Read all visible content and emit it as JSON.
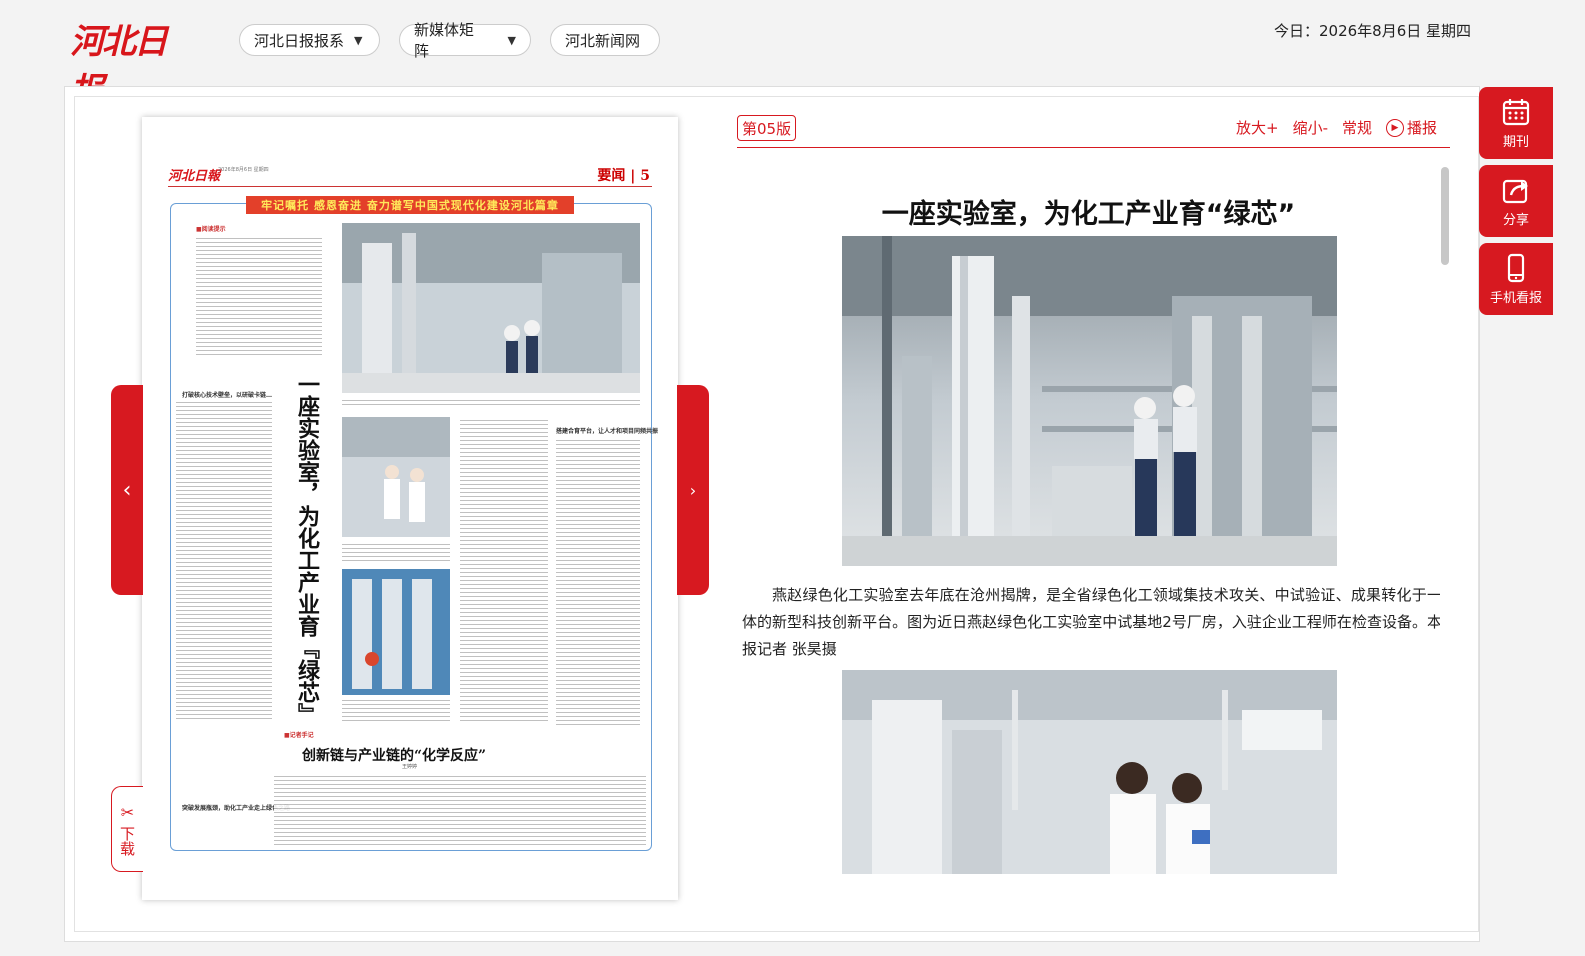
{
  "header": {
    "logo_text": "河北日报",
    "nav": [
      {
        "label": "河北日报报系",
        "has_dropdown": true
      },
      {
        "label": "新媒体矩阵",
        "has_dropdown": true
      },
      {
        "label": "河北新闻网",
        "has_dropdown": false
      }
    ],
    "date": "今日：2026年8月6日 星期四"
  },
  "paper": {
    "logo": "河北日報",
    "meta": "2026年8月6日 星期四",
    "section": "要闻 | 5",
    "banner": "牢记嘱托  感恩奋进  奋力谱写中国式现代化建设河北篇章",
    "tip_label": "■阅读提示",
    "vertical_title": "一座实验室，为化工产业育『绿芯』",
    "subheads": [
      "打破核心技术壁垒，以研破卡链…",
      "搭建合育平台，让人才和项目同频共振",
      "突破发展瓶颈，助化工产业走上绿色之路"
    ],
    "note_label": "■记者手记",
    "subtitle": "创新链与产业链的“化学反应”",
    "byline": "王婷婷"
  },
  "arrows": {
    "prev": "‹",
    "next": "›"
  },
  "download": {
    "label": "下载"
  },
  "article": {
    "edition": "第05版",
    "tools": {
      "zoom_in": "放大+",
      "zoom_out": "缩小-",
      "normal": "常规",
      "play": "播报"
    },
    "title": "一座实验室，为化工产业育“绿芯”",
    "caption": "燕赵绿色化工实验室去年底在沧州揭牌，是全省绿色化工领域集技术攻关、中试验证、成果转化于一体的新型科技创新平台。图为近日燕赵绿色化工实验室中试基地2号厂房，入驻企业工程师在检查设备。本报记者 张昊摄"
  },
  "side_buttons": [
    {
      "label": "期刊",
      "icon": "calendar-icon"
    },
    {
      "label": "分享",
      "icon": "share-icon"
    },
    {
      "label": "手机看报",
      "icon": "phone-icon"
    }
  ],
  "colors": {
    "brand_red": "#d71920",
    "banner_yellow": "#ffe95a"
  }
}
